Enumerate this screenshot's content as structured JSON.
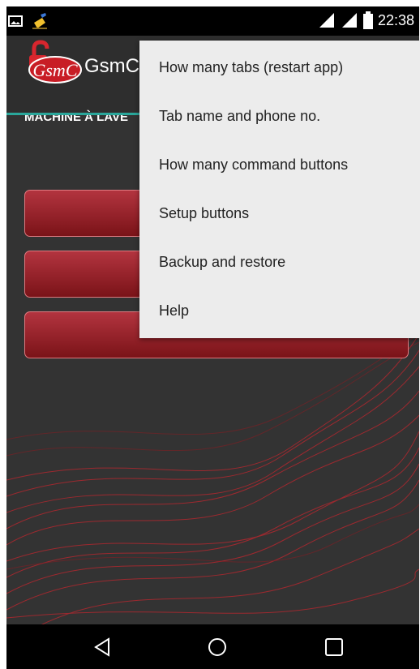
{
  "status_bar": {
    "time": "22:38",
    "left_icons": [
      "image-icon",
      "cleaner-broom-icon"
    ],
    "right_icons": [
      "signal-icon",
      "signal-icon",
      "battery-icon"
    ]
  },
  "app_bar": {
    "logo_text": "GsmC",
    "title": "GsmC"
  },
  "tabs": [
    {
      "label": "MACHINE À LAVE"
    }
  ],
  "colors": {
    "accent": "#2aa79b",
    "button_top": "#b3343f",
    "button_bottom": "#7a1318",
    "background": "#333333",
    "menu_background": "#ececec"
  },
  "command_buttons_count": 3,
  "menu": {
    "items": [
      {
        "label": "How many tabs (restart app)"
      },
      {
        "label": "Tab name and phone no."
      },
      {
        "label": "How many command buttons"
      },
      {
        "label": "Setup buttons"
      },
      {
        "label": "Backup and restore"
      },
      {
        "label": "Help"
      }
    ]
  },
  "nav_bar": {
    "icons": [
      "back-icon",
      "home-icon",
      "recents-icon"
    ]
  }
}
